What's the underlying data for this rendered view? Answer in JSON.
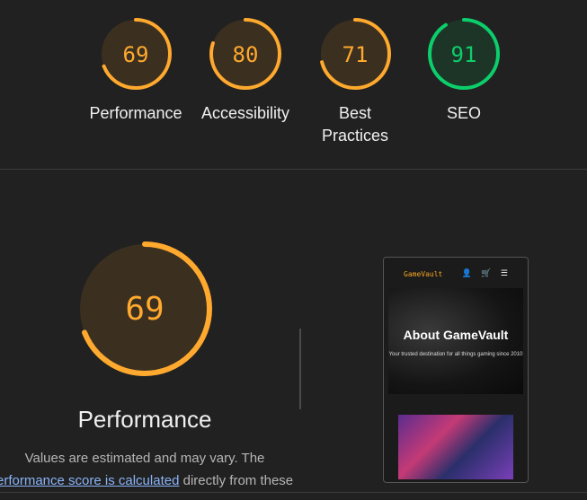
{
  "scores": [
    {
      "label": "Performance",
      "value": 69,
      "color": "#ffa92e",
      "track": "#3b2f20"
    },
    {
      "label": "Accessibility",
      "value": 80,
      "color": "#ffa92e",
      "track": "#3b2f20"
    },
    {
      "label": "Best Practices",
      "value": 71,
      "color": "#ffa92e",
      "track": "#3b2f20"
    },
    {
      "label": "SEO",
      "value": 91,
      "color": "#0cce6b",
      "track": "#1d3527"
    }
  ],
  "detail": {
    "score": 69,
    "title": "Performance",
    "desc_line1": "Values are estimated and may vary. The",
    "desc_link": "erformance score is calculated",
    "desc_line2_rest": " directly from these"
  },
  "preview": {
    "brand": "GameVault",
    "nav_icons": "👤 🛒 ☰",
    "hero_title": "About GameVault",
    "hero_subtitle": "Your trusted destination for all things gaming since 2010"
  }
}
